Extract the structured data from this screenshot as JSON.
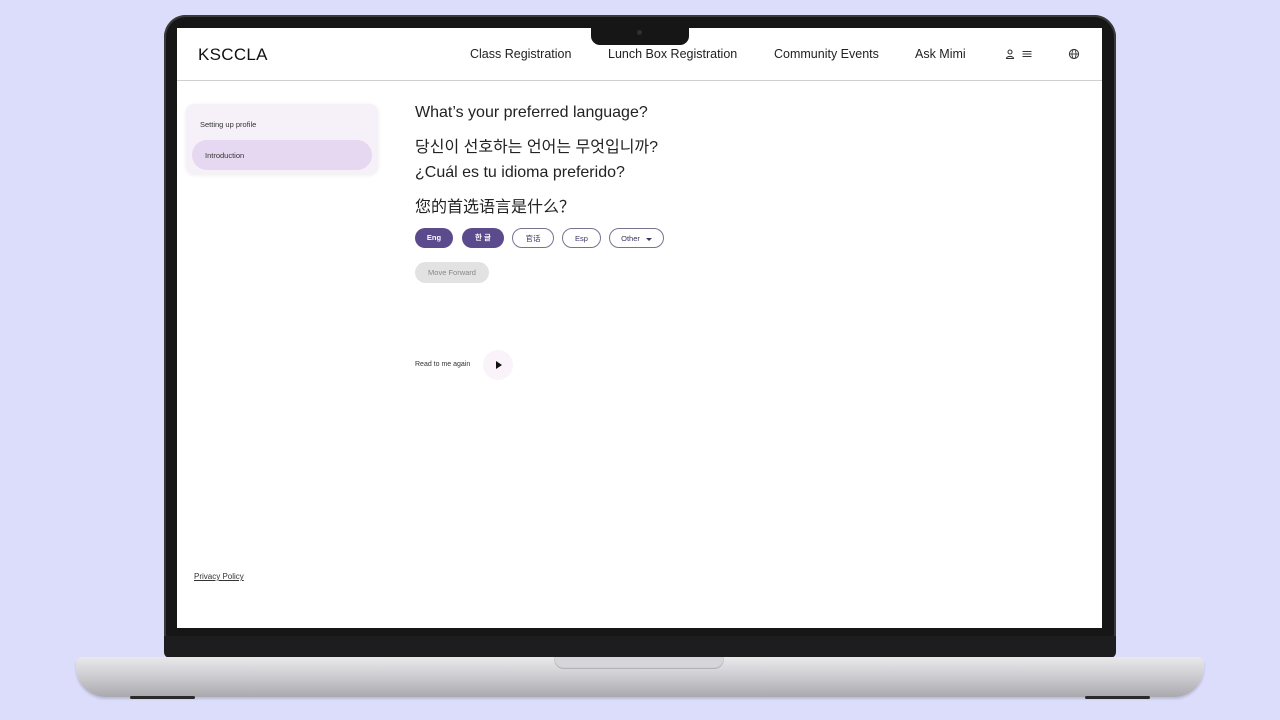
{
  "app": {
    "brand": "KSCCLA"
  },
  "nav": {
    "links": [
      "Class Registration",
      "Lunch Box Registration",
      "Community Events",
      "Ask Mimi"
    ],
    "icons": [
      "user-icon",
      "menu-icon",
      "globe-icon"
    ]
  },
  "sidebar": {
    "heading": "Setting up profile",
    "items": [
      {
        "label": "Introduction",
        "active": true
      }
    ]
  },
  "main": {
    "questions": [
      "What’s your preferred language?",
      "당신이 선호하는 언어는 무엇입니까?",
      "¿Cuál es tu idioma preferido?",
      "您的首选语言是什么？"
    ],
    "languages": [
      {
        "label": "Eng",
        "selected": true
      },
      {
        "label": "한 글",
        "selected": true
      },
      {
        "label": "官话",
        "selected": false
      },
      {
        "label": "Esp",
        "selected": false
      },
      {
        "label": "Other",
        "selected": false
      }
    ],
    "move_forward": "Move Forward",
    "read_again": "Read to me again"
  },
  "footer": {
    "privacy": "Privacy Policy"
  },
  "colors": {
    "background": "#dcdcfb",
    "accent": "#5b4a8c",
    "sidebar_active": "#e6d8f1"
  }
}
